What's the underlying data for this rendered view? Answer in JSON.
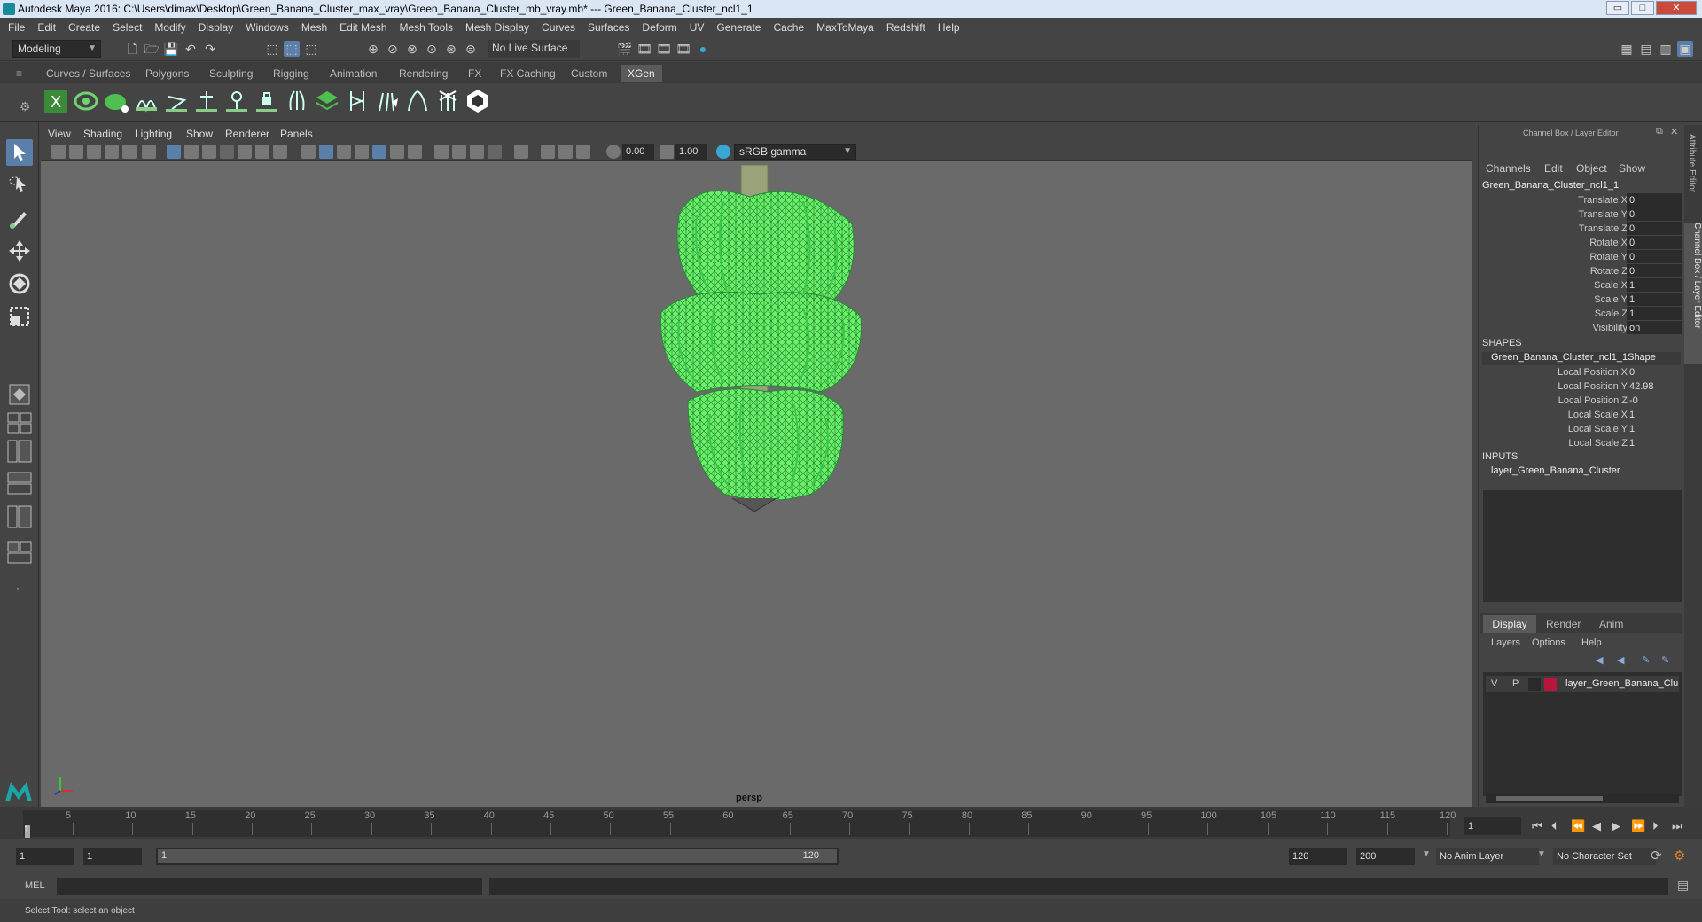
{
  "window": {
    "title": "Autodesk Maya 2016: C:\\Users\\dimax\\Desktop\\Green_Banana_Cluster_max_vray\\Green_Banana_Cluster_mb_vray.mb*   ---   Green_Banana_Cluster_ncl1_1",
    "min_glyph": "▭",
    "max_glyph": "□",
    "close_glyph": "✕"
  },
  "menubar": [
    "File",
    "Edit",
    "Create",
    "Select",
    "Modify",
    "Display",
    "Windows",
    "Mesh",
    "Edit Mesh",
    "Mesh Tools",
    "Mesh Display",
    "Curves",
    "Surfaces",
    "Deform",
    "UV",
    "Generate",
    "Cache",
    "MaxToMaya",
    "Redshift",
    "Help"
  ],
  "statusline": {
    "mode": "Modeling",
    "live_surface": "No Live Surface"
  },
  "shelf": {
    "tabs": [
      "Curves / Surfaces",
      "Polygons",
      "Sculpting",
      "Rigging",
      "Animation",
      "Rendering",
      "FX",
      "FX Caching",
      "Custom",
      "XGen"
    ],
    "active_tab": "XGen"
  },
  "viewport": {
    "menus": [
      "View",
      "Shading",
      "Lighting",
      "Show",
      "Renderer",
      "Panels"
    ],
    "exposure": "0.00",
    "gamma": "1.00",
    "color_space": "sRGB gamma",
    "camera": "persp"
  },
  "channel_box": {
    "header": "Channel Box / Layer Editor",
    "menus": [
      "Channels",
      "Edit",
      "Object",
      "Show"
    ],
    "object_name": "Green_Banana_Cluster_ncl1_1",
    "channels": [
      {
        "label": "Translate X",
        "value": "0"
      },
      {
        "label": "Translate Y",
        "value": "0"
      },
      {
        "label": "Translate Z",
        "value": "0"
      },
      {
        "label": "Rotate X",
        "value": "0"
      },
      {
        "label": "Rotate Y",
        "value": "0"
      },
      {
        "label": "Rotate Z",
        "value": "0"
      },
      {
        "label": "Scale X",
        "value": "1"
      },
      {
        "label": "Scale Y",
        "value": "1"
      },
      {
        "label": "Scale Z",
        "value": "1"
      },
      {
        "label": "Visibility",
        "value": "on"
      }
    ],
    "shapes_header": "SHAPES",
    "shape_name": "Green_Banana_Cluster_ncl1_1Shape",
    "shape_channels": [
      {
        "label": "Local Position X",
        "value": "0"
      },
      {
        "label": "Local Position Y",
        "value": "42.98"
      },
      {
        "label": "Local Position Z",
        "value": "-0"
      },
      {
        "label": "Local Scale X",
        "value": "1"
      },
      {
        "label": "Local Scale Y",
        "value": "1"
      },
      {
        "label": "Local Scale Z",
        "value": "1"
      }
    ],
    "inputs_header": "INPUTS",
    "input_name": "layer_Green_Banana_Cluster"
  },
  "layer_editor": {
    "tabs": [
      "Display",
      "Render",
      "Anim"
    ],
    "active_tab": "Display",
    "menus": [
      "Layers",
      "Options",
      "Help"
    ],
    "layer": {
      "v": "V",
      "p": "P",
      "name": "layer_Green_Banana_Clu",
      "color": "#b8163c"
    }
  },
  "side_tabs": [
    "Attribute Editor",
    "Channel Box / Layer Editor"
  ],
  "timeline": {
    "ticks": [
      "5",
      "10",
      "15",
      "20",
      "25",
      "30",
      "35",
      "40",
      "45",
      "50",
      "55",
      "60",
      "65",
      "70",
      "75",
      "80",
      "85",
      "90",
      "95",
      "100",
      "105",
      "110",
      "115",
      "120"
    ],
    "current_frame_marker": "1",
    "current_frame": "1"
  },
  "range": {
    "start": "1",
    "playback_start": "1",
    "slider_start": "1",
    "slider_end": "120",
    "playback_end": "120",
    "end": "200",
    "anim_layer": "No Anim Layer",
    "character_set": "No Character Set"
  },
  "mel": {
    "label": "MEL"
  },
  "helpline": "Select Tool: select an object",
  "colors": {
    "banana": "#6cf06a",
    "wire": "#1a7a2a",
    "stalk": "#8a9a6a"
  }
}
